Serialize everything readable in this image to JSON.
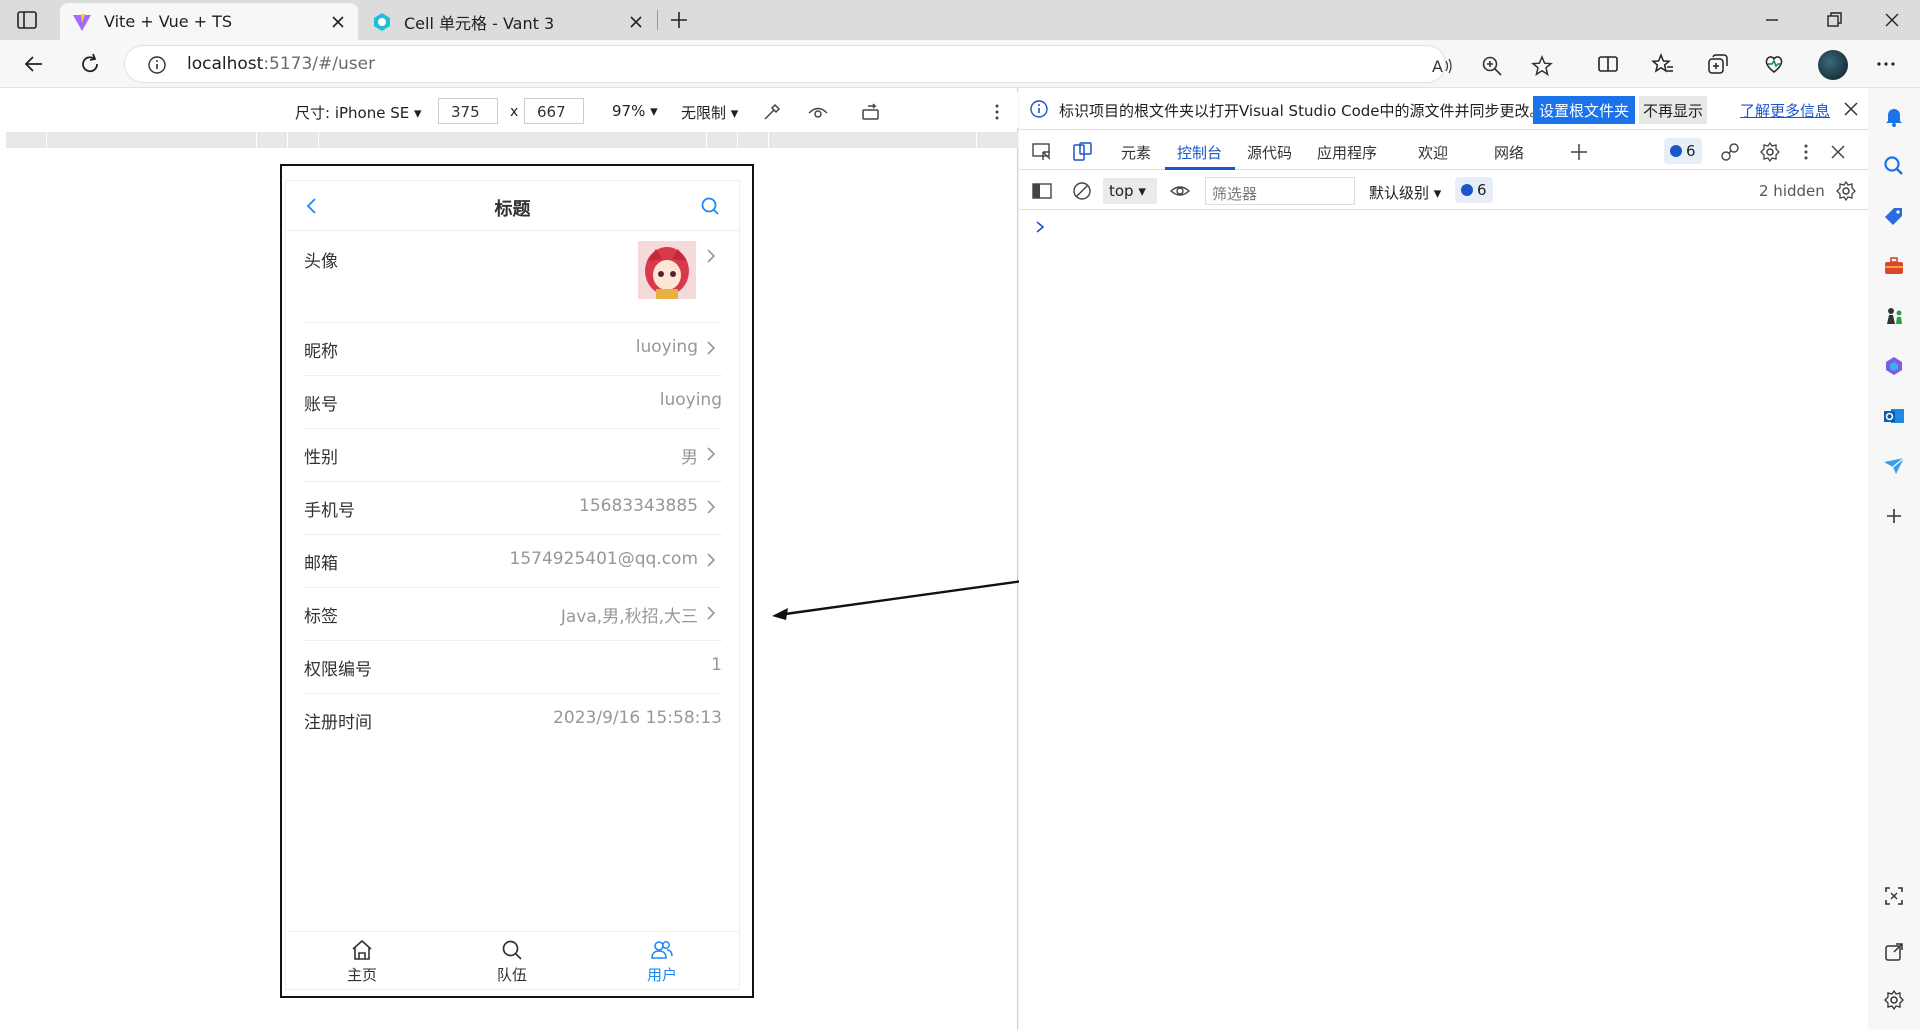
{
  "browser": {
    "tabs": [
      {
        "title": "Vite + Vue + TS",
        "active": true
      },
      {
        "title": "Cell 单元格 - Vant 3",
        "active": false
      }
    ],
    "url_host": "localhost",
    "url_rest": ":5173/#/user"
  },
  "device_toolbar": {
    "size_label": "尺寸: iPhone SE",
    "width": "375",
    "height": "667",
    "times": "x",
    "zoom": "97%",
    "throttle": "无限制"
  },
  "mobile": {
    "title": "标题",
    "cells": [
      {
        "label": "头像",
        "value": "",
        "arrow": true
      },
      {
        "label": "昵称",
        "value": "luoying",
        "arrow": true
      },
      {
        "label": "账号",
        "value": "luoying",
        "arrow": false
      },
      {
        "label": "性别",
        "value": "男",
        "arrow": true
      },
      {
        "label": "手机号",
        "value": "15683343885",
        "arrow": true
      },
      {
        "label": "邮箱",
        "value": "1574925401@qq.com",
        "arrow": true
      },
      {
        "label": "标签",
        "value": "Java,男,秋招,大三",
        "arrow": true
      },
      {
        "label": "权限编号",
        "value": "1",
        "arrow": false
      },
      {
        "label": "注册时间",
        "value": "2023/9/16 15:58:13",
        "arrow": false
      }
    ],
    "tabbar": [
      {
        "label": "主页",
        "icon": "home-icon",
        "active": false
      },
      {
        "label": "队伍",
        "icon": "search-icon",
        "active": false
      },
      {
        "label": "用户",
        "icon": "friends-icon",
        "active": true
      }
    ],
    "accent_color": "#1989fa"
  },
  "devtools": {
    "info_text": "标识项目的根文件夹以打开Visual Studio Code中的源文件并同步更改。",
    "set_root_button": "设置根文件夹",
    "dont_show_button": "不再显示",
    "learn_more_link": "了解更多信息",
    "tabs": [
      "元素",
      "控制台",
      "源代码",
      "应用程序",
      "欢迎",
      "网络"
    ],
    "active_tab": "控制台",
    "issues_count": "6",
    "context": "top",
    "filter_placeholder": "筛选器",
    "level": "默认级别",
    "hidden": "2 hidden"
  }
}
